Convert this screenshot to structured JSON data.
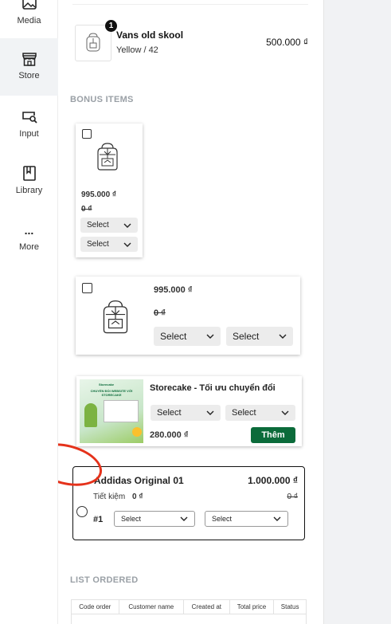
{
  "sidebar": {
    "items": [
      {
        "label": "Media",
        "icon": "image-icon"
      },
      {
        "label": "Store",
        "icon": "store-icon",
        "active": true
      },
      {
        "label": "Input",
        "icon": "input-search-icon"
      },
      {
        "label": "Library",
        "icon": "book-icon"
      },
      {
        "label": "More",
        "icon": "more-dots-icon",
        "glyph": "..."
      }
    ]
  },
  "cart": {
    "item": {
      "name": "Vans old skool",
      "variant": "Yellow / 42",
      "price": "500.000 ₫",
      "quantity": "1"
    }
  },
  "bonus": {
    "title": "BONUS ITEMS",
    "card1": {
      "price": "995.000 ₫",
      "compare_price": "0 ₫",
      "select1": "Select",
      "select2": "Select"
    },
    "card2": {
      "price": "995.000 ₫",
      "compare_price": "0 ₫",
      "select1": "Select",
      "select2": "Select"
    },
    "card3": {
      "name": "Storecake - Tối ưu chuyển đổi",
      "price": "280.000 ₫",
      "select1": "Select",
      "select2": "Select",
      "button": "Thêm",
      "banner_text": "CHUYỂN ĐỔI WEBSITE VỚI STORECAKE",
      "banner_brand": "Storecake"
    },
    "card4": {
      "name": "Addidas Original 01",
      "price": "1.000.000 ₫",
      "saving_label": "Tiết kiệm",
      "saving_value": "0 ₫",
      "compare_price": "0 ₫",
      "index": "#1",
      "select1": "Select",
      "select2": "Select"
    }
  },
  "orders": {
    "title": "LIST ORDERED",
    "columns": [
      "Code order",
      "Customer name",
      "Created at",
      "Total price",
      "Status"
    ]
  },
  "colors": {
    "accent_green": "#0b6b3a",
    "annotation_red": "#e5321b"
  }
}
